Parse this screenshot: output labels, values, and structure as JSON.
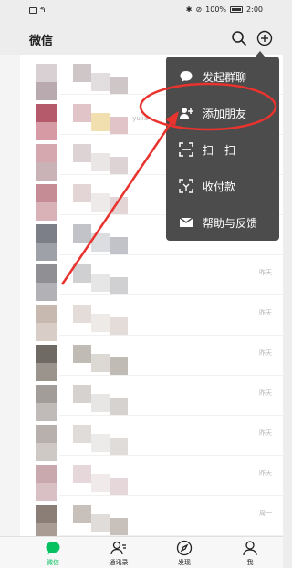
{
  "status_bar": {
    "signal": "⁴⁶ᵢₗₗ",
    "battery_percent": "100%",
    "time": "2:00"
  },
  "header": {
    "title": "微信",
    "search_icon": "search-icon",
    "plus_icon": "plus-circle-icon"
  },
  "chat_list": {
    "visible_times": [
      "昨天",
      "昨天",
      "昨天",
      "昨天",
      "昨天",
      "昨天",
      "周一"
    ],
    "partial_text": "yujia"
  },
  "popup_menu": {
    "items": [
      {
        "label": "发起群聊",
        "icon": "chat-bubble-icon"
      },
      {
        "label": "添加朋友",
        "icon": "add-friend-icon"
      },
      {
        "label": "扫一扫",
        "icon": "scan-icon"
      },
      {
        "label": "收付款",
        "icon": "payment-scan-icon"
      },
      {
        "label": "帮助与反馈",
        "icon": "mail-icon"
      }
    ]
  },
  "tab_bar": {
    "tabs": [
      {
        "label": "微信",
        "icon": "chat-icon",
        "active": true
      },
      {
        "label": "通讯录",
        "icon": "contacts-icon",
        "active": false
      },
      {
        "label": "发现",
        "icon": "compass-icon",
        "active": false
      },
      {
        "label": "我",
        "icon": "person-icon",
        "active": false
      }
    ]
  },
  "colors": {
    "accent": "#07c160",
    "menu_bg": "#4c4c4c",
    "annotation": "#e8332e"
  }
}
